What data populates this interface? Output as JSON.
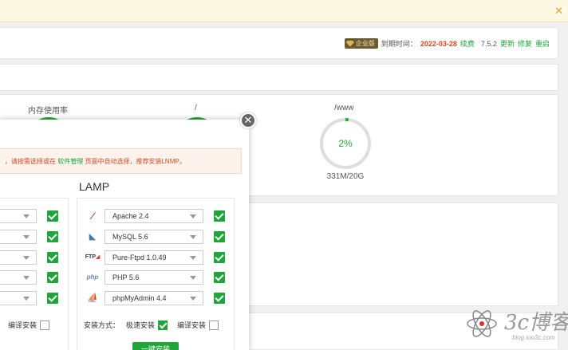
{
  "header": {
    "edition_badge": "企业版",
    "expire_label": "到期时间：",
    "expire_date": "2022-03-28",
    "renew": "续费",
    "version": "7.5.2",
    "update": "更新",
    "repair": "修复",
    "restart": "重启"
  },
  "stats": {
    "memory_label": "内存使用率",
    "root_label": "/",
    "www_label": "/www",
    "www_percent": 2,
    "www_percent_text": "2%",
    "www_size": "331M/20G"
  },
  "modal": {
    "warning_pre": "，请按需选择或在",
    "warning_mid": "软件管理",
    "warning_post": "页面中自动选择，推荐安装LNMP。",
    "lamp_title": "LAMP",
    "lamp_items": [
      {
        "icon": "apache-icon",
        "value": "Apache 2.4",
        "checked": true
      },
      {
        "icon": "mysql-icon",
        "value": "MySQL 5.6",
        "checked": true
      },
      {
        "icon": "ftp-icon",
        "value": "Pure-Ftpd 1.0.49",
        "checked": true
      },
      {
        "icon": "php-icon",
        "value": "PHP 5.6",
        "checked": true
      },
      {
        "icon": "phpmyadmin-icon",
        "value": "phpMyAdmin 4.4",
        "checked": true
      }
    ],
    "install_method_label": "安装方式：",
    "fast_install": "极速安装",
    "compile_install": "编译安装",
    "left_compile_install": "编译安装",
    "install_button": "一键安装"
  },
  "watermark": {
    "text": "3c博客",
    "url": "blog.ioo3c.com"
  },
  "colors": {
    "accent": "#20a53a",
    "warning": "#d8491f"
  }
}
